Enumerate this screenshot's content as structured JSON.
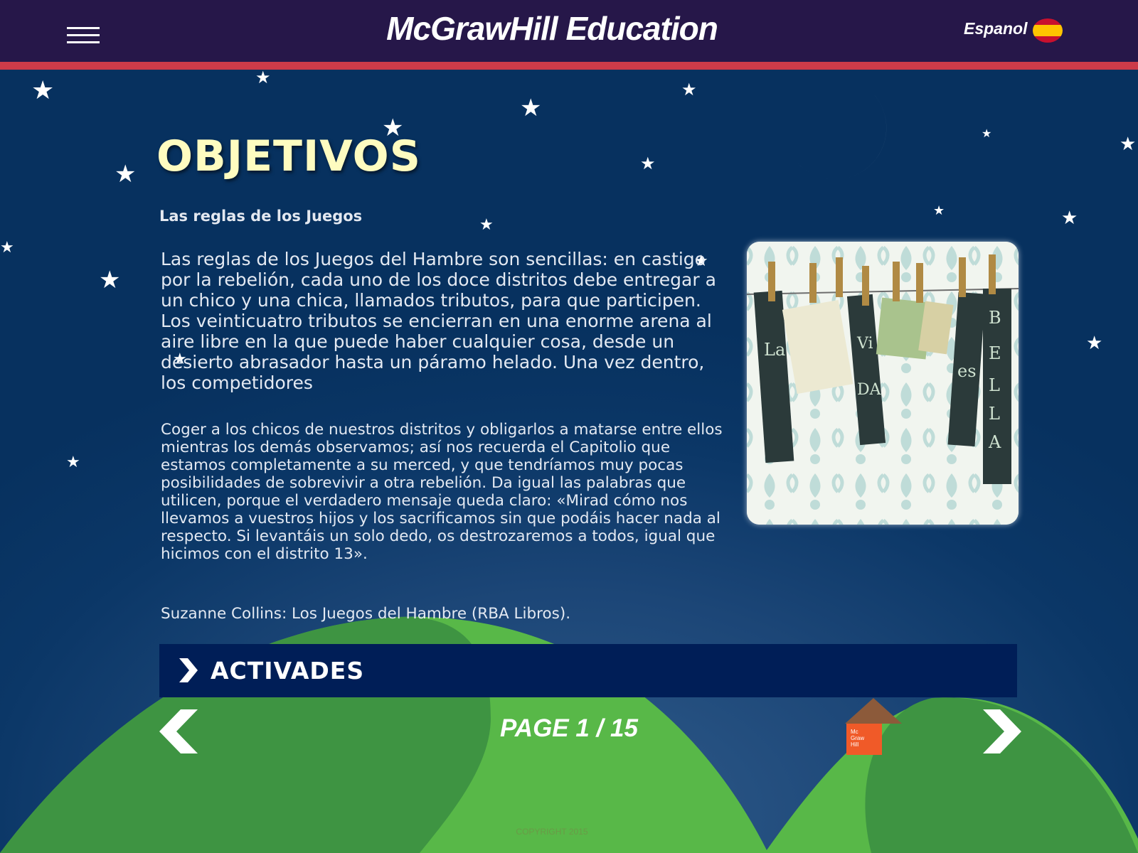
{
  "header": {
    "brand": "McGrawHill Education",
    "language_label": "Espanol"
  },
  "content": {
    "title": "OBJETIVOS",
    "subtitle": "Las reglas de los Juegos",
    "paragraph1": "Las reglas de los Juegos del Hambre son sencillas: en castigo por la rebelión, cada uno de los doce distritos debe entregar a un chico y una chica, llamados tributos, para que participen. Los veinticuatro tributos se encierran en una enorme arena al aire libre en la que puede haber cualquier cosa, desde un desierto abrasador hasta un páramo helado. Una vez dentro, los competidores",
    "paragraph2": "Coger a los chicos de nuestros distritos y obligarlos a matarse entre ellos mientras los demás observamos; así nos recuerda el Capitolio que estamos completamente a su merced, y que tendríamos muy pocas posibilidades de sobrevivir a otra rebelión. Da igual las palabras que utilicen, porque el verdadero mensaje queda claro: «Mirad cómo nos llevamos a vuestros hijos y los sacrificamos sin que podáis hacer nada al respecto. Si levantáis un solo dedo, os destrozaremos a todos, igual que hicimos con el distrito 13».",
    "source": "Suzanne Collins: Los Juegos del Hambre (RBA Libros).",
    "illustration_letters": [
      "La",
      "Vi",
      "DA",
      "es",
      "BELLA"
    ]
  },
  "activities": {
    "label": "ACTIVADES"
  },
  "pagination": {
    "current": "1",
    "total": "15",
    "text": "PAGE 1 / 15"
  },
  "footer": {
    "copyright": "COPYRIGHT 2015"
  },
  "colors": {
    "header_bg": "#261749",
    "header_stripe": "#cd3b49",
    "title": "#fefcc0",
    "activities_bar": "#001e57",
    "hill_light": "#58b848",
    "hill_dark": "#3e9442"
  },
  "icons": [
    "menu-icon",
    "spain-flag-icon",
    "moon-icon",
    "star-icon",
    "chevron-right-icon",
    "arrow-left-icon",
    "arrow-right-icon",
    "house-icon"
  ]
}
